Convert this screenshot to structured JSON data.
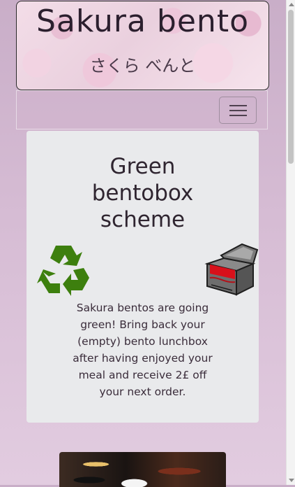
{
  "header": {
    "title": "Sakura bento",
    "subtitle": "さくら べんと"
  },
  "nav": {
    "toggle_icon": "hamburger-menu-icon"
  },
  "promo": {
    "heading": "Green bentobox scheme",
    "left_icon": "recycle-icon",
    "right_icon": "bento-box-icon",
    "body": "Sakura bentos are going green! Bring back your (empty) bento lunchbox after having enjoyed your meal and receive 2£ off your next order."
  },
  "colors": {
    "background": "#d6bcd4",
    "card": "#e9eaec",
    "recycle_green": "#3d7f0e",
    "box_red": "#d8101a"
  }
}
